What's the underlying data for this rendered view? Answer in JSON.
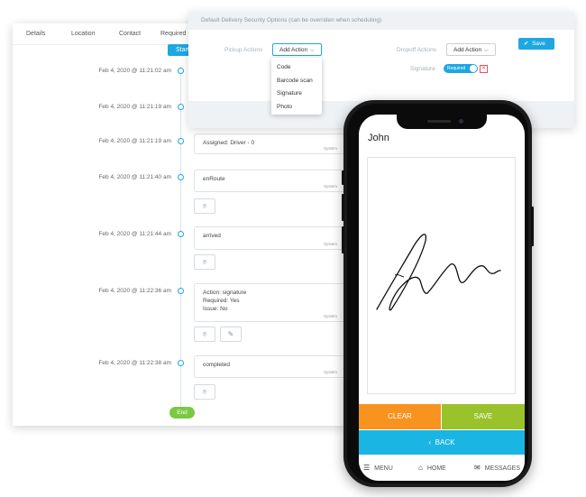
{
  "timeline": {
    "tabs": [
      "Details",
      "Location",
      "Contact",
      "Required Sk"
    ],
    "start_label": "Start",
    "end_label": "End",
    "events": [
      {
        "time": "Feb 4, 2020 @ 11:21:02 am"
      },
      {
        "time": "Feb 4, 2020 @ 11:21:19 am"
      },
      {
        "time": "Feb 4, 2020 @ 11:21:19 am",
        "lines": [
          "Assigned: Driver - 0"
        ],
        "source": "System"
      },
      {
        "time": "Feb 4, 2020 @ 11:21:40 am",
        "lines": [
          "enRoute"
        ],
        "source": "System"
      },
      {
        "time": "Feb 4, 2020 @ 11:21:44 am",
        "lines": [
          "arrived"
        ],
        "source": "System"
      },
      {
        "time": "Feb 4, 2020 @ 11:22:36 am",
        "lines": [
          "Action: signature",
          "Required: Yes",
          "Issue: No"
        ],
        "source": "System"
      },
      {
        "time": "Feb 4, 2020 @ 11:22:38 am",
        "lines": [
          "completed"
        ],
        "source": "System"
      }
    ]
  },
  "options": {
    "header": "Default Delivery Security Options (can be overriden when scheduling)",
    "pickup_label": "Pickup Actions",
    "dropoff_label": "Dropoff Actions",
    "add_action_label": "Add Action",
    "save_label": "Save",
    "signature_label": "Signature",
    "required_label": "Required",
    "remove_glyph": "✕",
    "menu_items": [
      "Code",
      "Barcode scan",
      "Signature",
      "Photo"
    ]
  },
  "phone": {
    "signer_name": "John",
    "clear_label": "CLEAR",
    "save_label": "SAVE",
    "back_label": "BACK",
    "nav": {
      "menu": "MENU",
      "home": "HOME",
      "messages": "MESSAGES"
    }
  },
  "colors": {
    "accent": "#1ea7e1",
    "clear": "#f7931e",
    "save": "#9ac22a",
    "back": "#1ab5e2",
    "end": "#7ac943"
  }
}
